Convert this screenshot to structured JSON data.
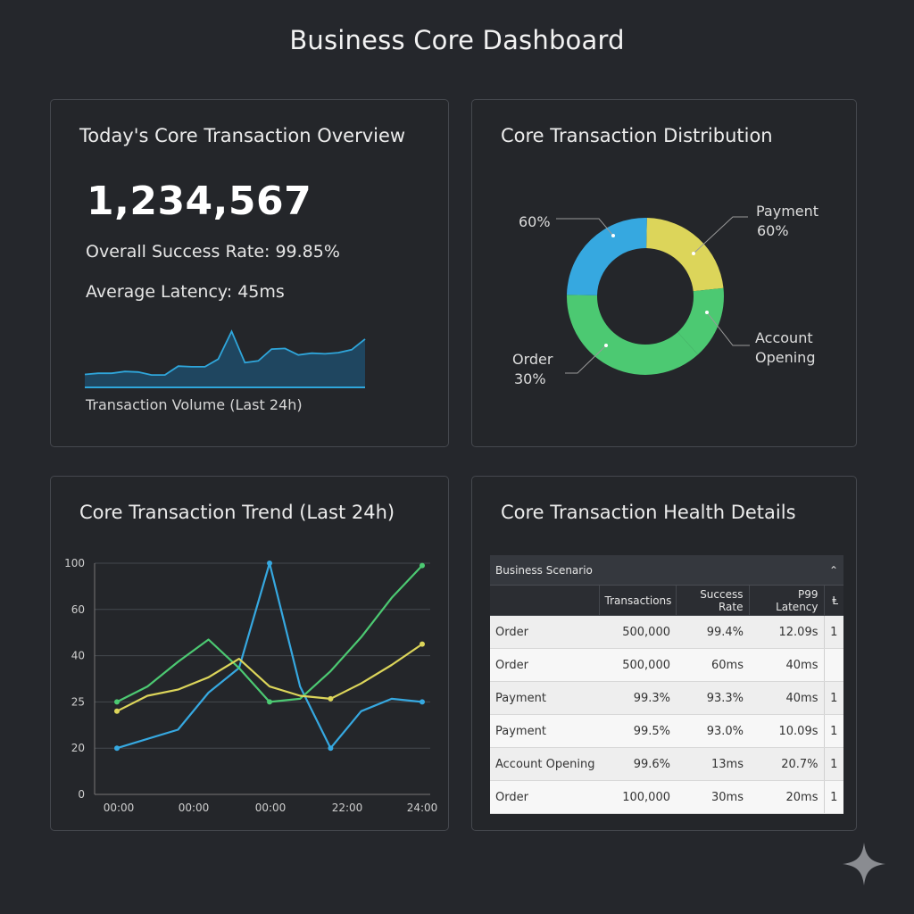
{
  "page_title": "Business Core Dashboard",
  "overview": {
    "title": "Today's Core Transaction Overview",
    "total": "1,234,567",
    "success_rate": "Overall Success Rate: 99.85%",
    "latency": "Average Latency: 45ms",
    "caption": "Transaction Volume (Last 24h)",
    "sparkline_color": "#2fa6db"
  },
  "distribution": {
    "title": "Core Transaction Distribution",
    "callouts": {
      "left_top": "60%",
      "payment_name": "Payment",
      "payment_pct": "60%",
      "account_line1": "Account",
      "account_line2": "Opening",
      "order_name": "Order",
      "order_pct": "30%"
    },
    "colors": {
      "blue": "#36a8e0",
      "yellow": "#dcd55a",
      "green": "#4cc972"
    }
  },
  "trend": {
    "title": "Core Transaction Trend (Last 24h)",
    "y_ticks": [
      "100",
      "60",
      "40",
      "25",
      "20",
      "0"
    ],
    "x_ticks": [
      "00:00",
      "00:00",
      "00:00",
      "22:00",
      "24:00"
    ],
    "colors": {
      "blue": "#36a8e0",
      "green": "#4cc972",
      "yellow": "#dcd55a"
    }
  },
  "health": {
    "title": "Core Transaction Health Details",
    "scenario_label": "Business Scenario",
    "columns": [
      "",
      "Transactions",
      "Success Rate",
      "P99 Latency",
      "Ⱡ"
    ],
    "rows": [
      [
        "Order",
        "500,000",
        "99.4%",
        "12.09s",
        "1"
      ],
      [
        "Order",
        "500,000",
        "60ms",
        "40ms",
        ""
      ],
      [
        "Payment",
        "99.3%",
        "93.3%",
        "40ms",
        "1"
      ],
      [
        "Payment",
        "99.5%",
        "93.0%",
        "10.09s",
        "1"
      ],
      [
        "Account Opening",
        "99.6%",
        "13ms",
        "20.7%",
        "1"
      ],
      [
        "Order",
        "100,000",
        "30ms",
        "20ms",
        "1"
      ]
    ]
  },
  "chart_data": [
    {
      "type": "area",
      "title": "",
      "xlabel": "Transaction Volume (Last 24h)",
      "ylabel": "",
      "series": [
        {
          "name": "",
          "values": [
            22,
            24,
            24,
            27,
            26,
            21,
            21,
            36,
            35,
            35,
            48,
            95,
            42,
            45,
            65,
            66,
            55,
            58,
            57,
            59,
            64,
            82
          ]
        }
      ]
    },
    {
      "type": "pie",
      "title": "",
      "categories": [
        "Payment",
        "Account Opening",
        "Order",
        ""
      ],
      "values": [
        23,
        15,
        37,
        25
      ],
      "colors": [
        "#dcd55a",
        "#4cc972",
        "#4cc972",
        "#36a8e0"
      ]
    },
    {
      "type": "line",
      "title": "",
      "x": [
        "00:00",
        "",
        "00:00",
        "",
        "00:00",
        "",
        "",
        "22:00",
        "",
        "24:00"
      ],
      "series": [
        {
          "name": "",
          "color": "#36a8e0",
          "values": [
            20,
            21,
            22,
            28,
            36,
            100,
            30,
            20,
            24,
            26,
            25
          ]
        },
        {
          "name": "",
          "color": "#4cc972",
          "values": [
            25,
            30,
            38,
            47,
            36,
            25,
            26,
            35,
            48,
            70,
            98
          ]
        },
        {
          "name": "",
          "color": "#dcd55a",
          "values": [
            24,
            27,
            29,
            33,
            39,
            30,
            27,
            26,
            31,
            37,
            45
          ]
        }
      ]
    }
  ]
}
